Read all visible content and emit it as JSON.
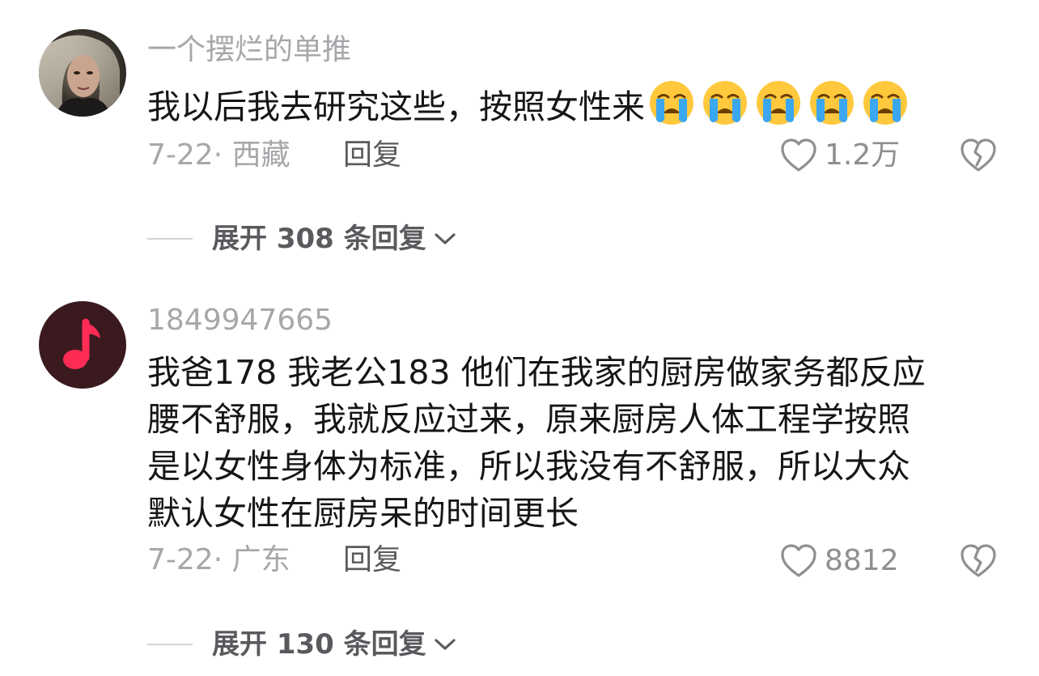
{
  "comments": [
    {
      "username": "一个摆烂的单推",
      "body_lines": [
        "我以后我去研究这些，按照女性来"
      ],
      "emoji_icons": [
        "crying-face-icon",
        "crying-face-icon",
        "crying-face-icon",
        "crying-face-icon",
        "crying-face-icon"
      ],
      "meta": "7-22· 西藏",
      "reply_label": "回复",
      "like_count": "1.2万",
      "expand_label": "展开 308 条回复"
    },
    {
      "username": "1849947665",
      "body_lines": [
        "我爸178 我老公183 他们在我家的厨房做家务都反应",
        "腰不舒服，我就反应过来，原来厨房人体工程学按照",
        "是以女性身体为标准，所以我没有不舒服，所以大众",
        "默认女性在厨房呆的时间更长"
      ],
      "meta": "7-22· 广东",
      "reply_label": "回复",
      "like_count": "8812",
      "expand_label": "展开 130 条回复"
    }
  ],
  "colors": {
    "secondary_text": "#a7a7ab",
    "reply_text": "#5a5a5e",
    "music_avatar_bg": "#3a1a1f",
    "music_note": "#fe2c55"
  }
}
